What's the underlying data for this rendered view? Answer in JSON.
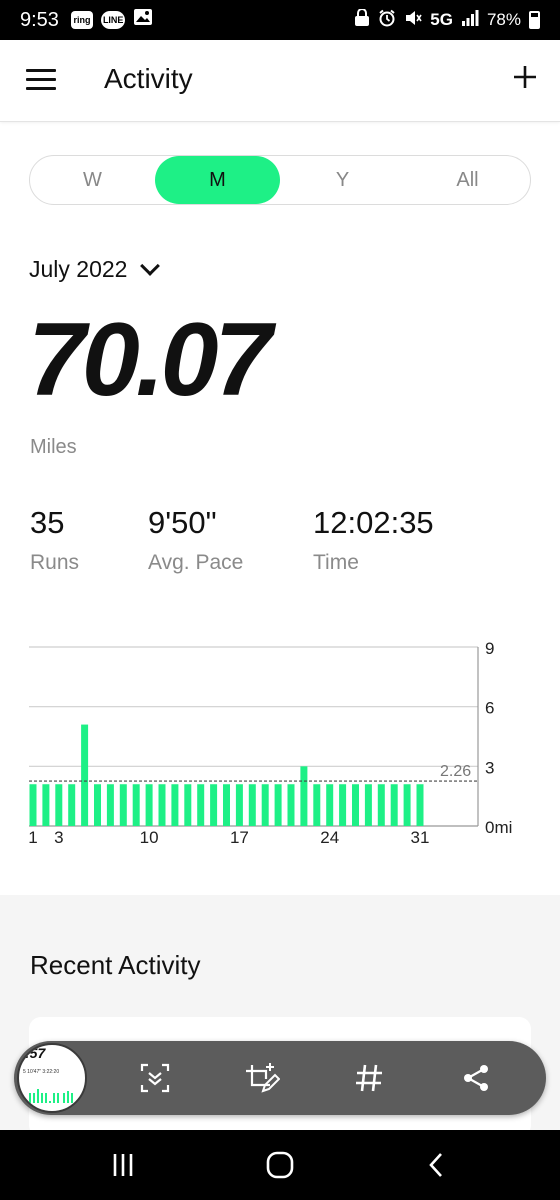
{
  "status_bar": {
    "time": "9:53",
    "notif_icons": [
      "ring",
      "LINE",
      "gallery-icon"
    ],
    "network": "5G",
    "battery": "78%"
  },
  "app_bar": {
    "title": "Activity"
  },
  "period_tabs": [
    {
      "label": "W",
      "active": false
    },
    {
      "label": "M",
      "active": true
    },
    {
      "label": "Y",
      "active": false
    },
    {
      "label": "All",
      "active": false
    }
  ],
  "month_selector": "July 2022",
  "summary": {
    "distance": "70.07",
    "unit": "Miles",
    "stats": [
      {
        "value": "35",
        "label": "Runs"
      },
      {
        "value": "9'50\"",
        "label": "Avg. Pace"
      },
      {
        "value": "12:02:35",
        "label": "Time"
      }
    ]
  },
  "chart_data": {
    "type": "bar",
    "x": [
      1,
      2,
      3,
      4,
      5,
      6,
      7,
      8,
      9,
      10,
      11,
      12,
      13,
      14,
      15,
      16,
      17,
      18,
      19,
      20,
      21,
      22,
      23,
      24,
      25,
      26,
      27,
      28,
      29,
      30,
      31
    ],
    "values": [
      2.1,
      2.1,
      2.1,
      2.1,
      5.1,
      2.1,
      2.1,
      2.1,
      2.1,
      2.1,
      2.1,
      2.1,
      2.1,
      2.1,
      2.1,
      2.1,
      2.1,
      2.1,
      2.1,
      2.1,
      2.1,
      3.0,
      2.1,
      2.1,
      2.1,
      2.1,
      2.1,
      2.1,
      2.1,
      2.1,
      2.1
    ],
    "x_tick_labels": [
      "1",
      "3",
      "10",
      "17",
      "24",
      "31"
    ],
    "x_tick_days": [
      1,
      3,
      10,
      17,
      24,
      31
    ],
    "y_ticks": [
      "9",
      "6",
      "3",
      "0mi"
    ],
    "y_tick_values": [
      9,
      6,
      3,
      0
    ],
    "average": 2.26,
    "average_label": "2.26",
    "ylim": [
      0,
      9
    ],
    "bar_color": "#1ef086",
    "grid": true
  },
  "recent": {
    "title": "Recent Activity"
  },
  "thumbnail": {
    "distance": ":57",
    "row": "5   10'47\"   3:22:20"
  },
  "screenshot_toolbar": [
    "scroll-capture-icon",
    "crop-edit-icon",
    "hashtag-icon",
    "share-icon"
  ],
  "nav_bar": [
    "recent-apps-icon",
    "home-icon",
    "back-icon"
  ],
  "colors": {
    "accent": "#1ef086",
    "muted": "#8a8a8a"
  }
}
